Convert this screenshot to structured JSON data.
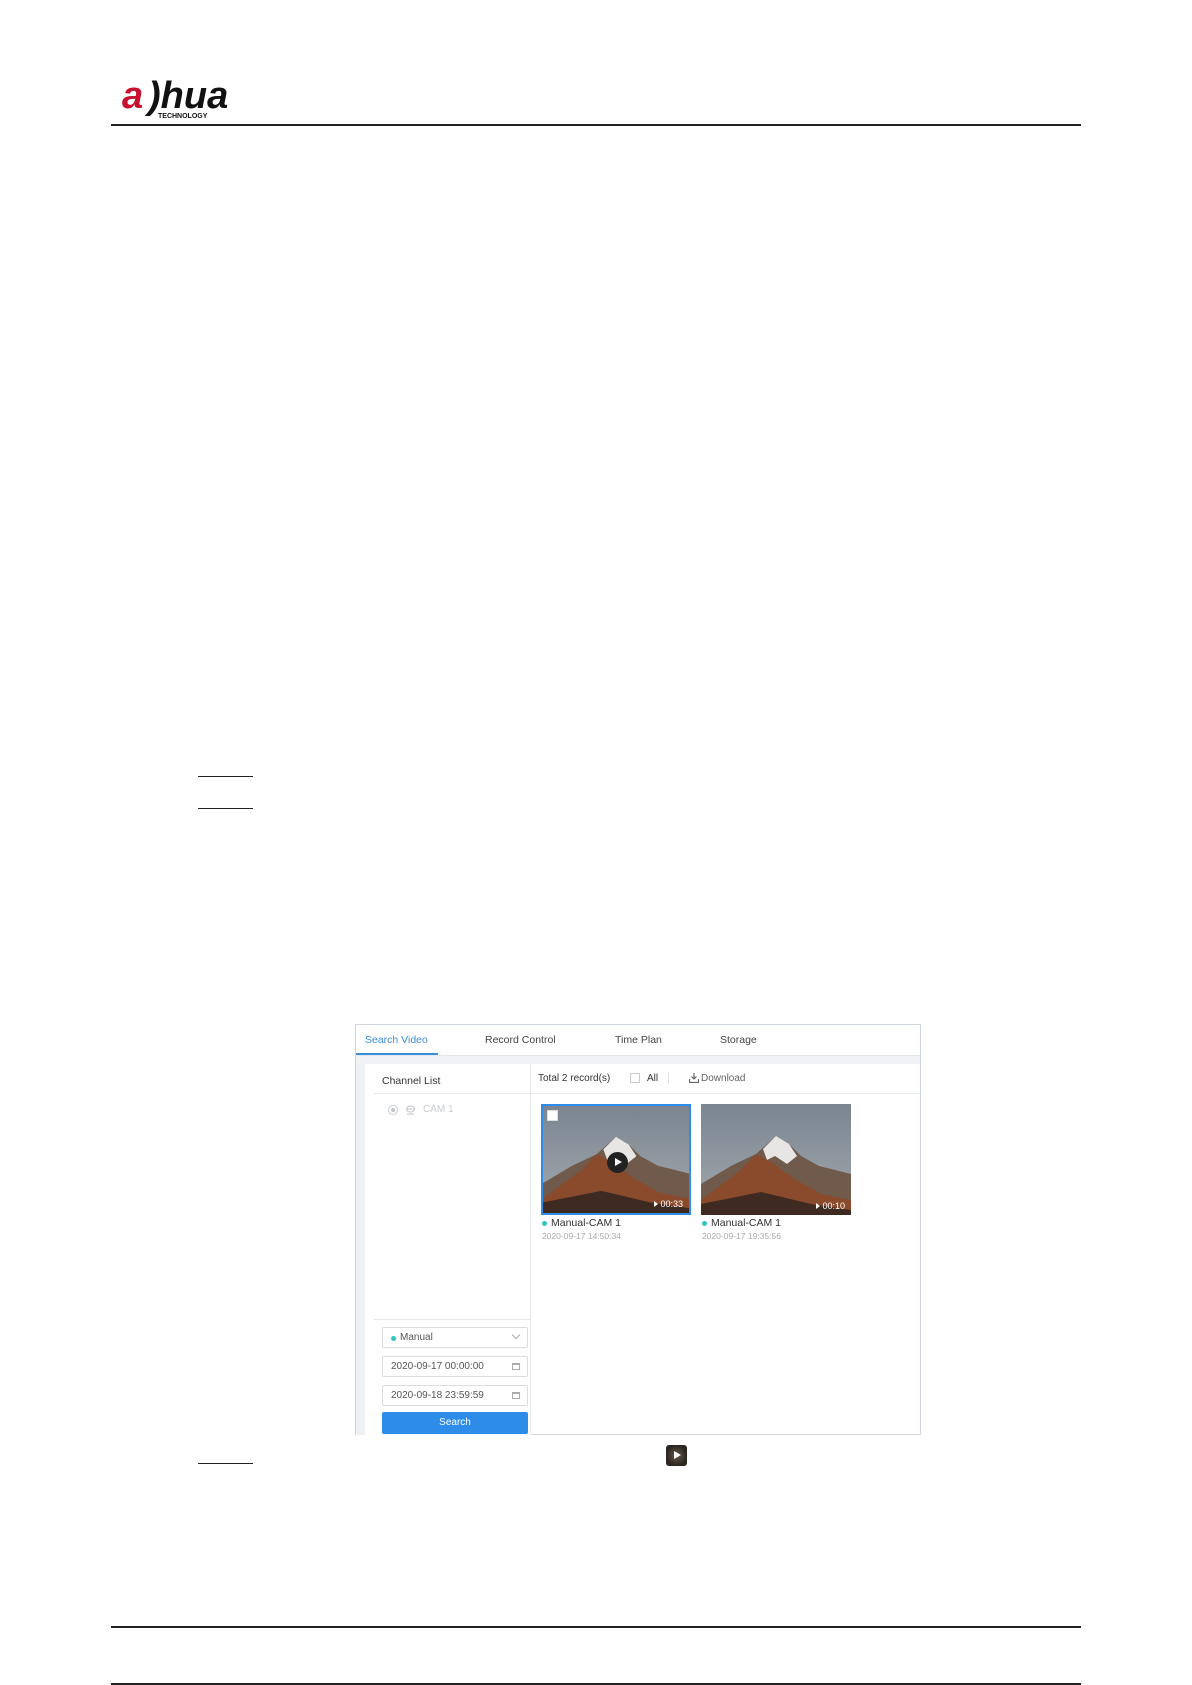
{
  "header": {
    "logo_text": "alhua",
    "logo_sub": "TECHNOLOGY"
  },
  "screenshot": {
    "tabs": [
      {
        "label": "Search Video",
        "active": true
      },
      {
        "label": "Record Control",
        "active": false
      },
      {
        "label": "Time Plan",
        "active": false
      },
      {
        "label": "Storage",
        "active": false
      }
    ],
    "sidebar": {
      "title": "Channel List",
      "channel": "CAM 1",
      "record_type": "Manual",
      "start_time": "2020-09-17 00:00:00",
      "end_time": "2020-09-18 23:59:59",
      "search_label": "Search"
    },
    "toolbar": {
      "total": "Total 2 record(s)",
      "all_label": "All",
      "download_label": "Download"
    },
    "records": [
      {
        "name": "Manual-CAM 1",
        "datetime": "2020-09-17 14:50:34",
        "duration": "00:33",
        "selected": true
      },
      {
        "name": "Manual-CAM 1",
        "datetime": "2020-09-17 19:35:56",
        "duration": "00:10",
        "selected": false
      }
    ],
    "colors": {
      "accent": "#2d8ce8",
      "manual_dot": "#2dc6c0"
    }
  }
}
